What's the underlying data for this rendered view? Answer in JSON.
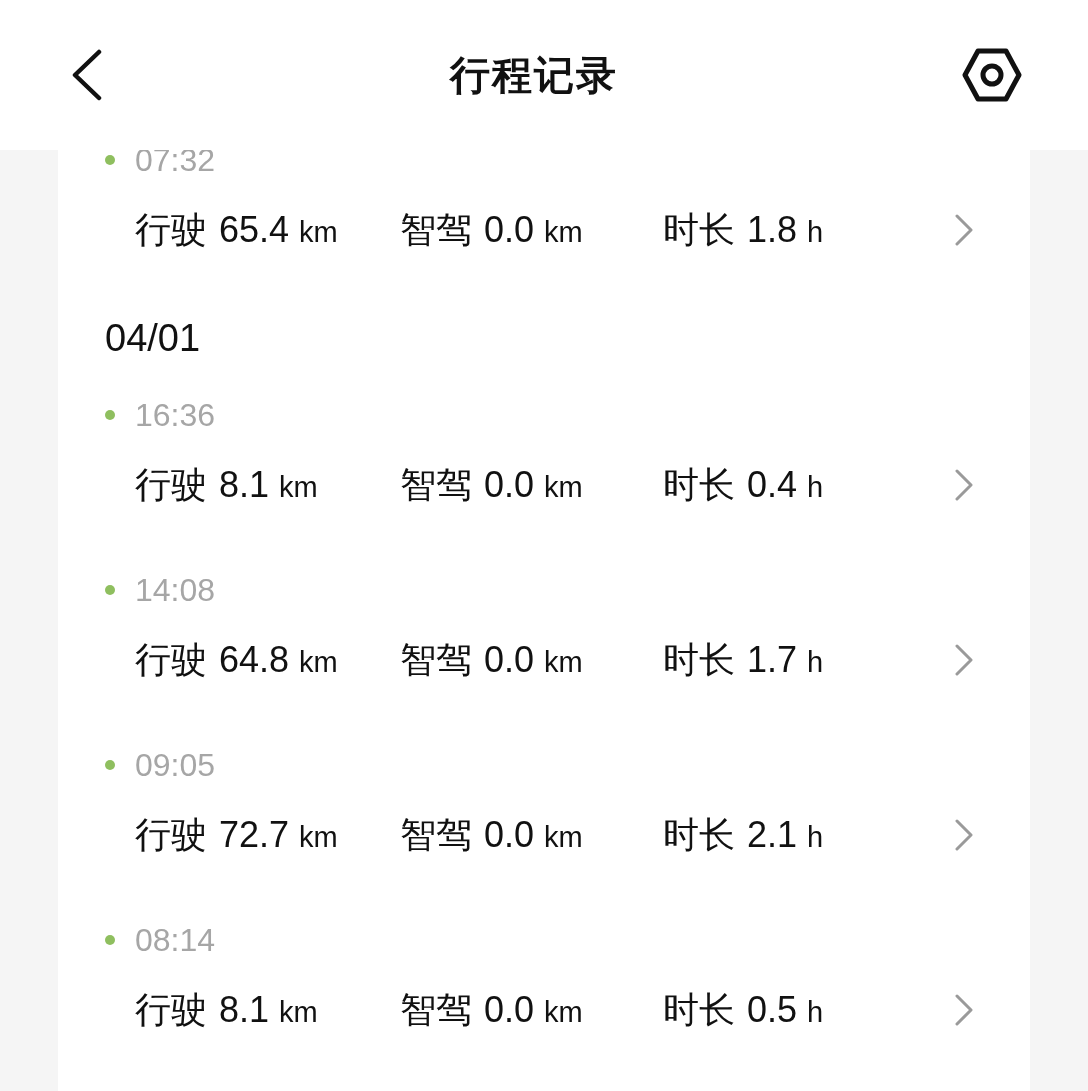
{
  "header": {
    "title": "行程记录"
  },
  "groups": [
    {
      "trips": [
        {
          "time": "07:32",
          "stats": [
            {
              "label": "行驶",
              "value": "65.4",
              "unit": "km"
            },
            {
              "label": "智驾",
              "value": "0.0",
              "unit": "km"
            },
            {
              "label": "时长",
              "value": "1.8",
              "unit": "h"
            }
          ]
        }
      ]
    },
    {
      "date": "04/01",
      "trips": [
        {
          "time": "16:36",
          "stats": [
            {
              "label": "行驶",
              "value": "8.1",
              "unit": "km"
            },
            {
              "label": "智驾",
              "value": "0.0",
              "unit": "km"
            },
            {
              "label": "时长",
              "value": "0.4",
              "unit": "h"
            }
          ]
        },
        {
          "time": "14:08",
          "stats": [
            {
              "label": "行驶",
              "value": "64.8",
              "unit": "km"
            },
            {
              "label": "智驾",
              "value": "0.0",
              "unit": "km"
            },
            {
              "label": "时长",
              "value": "1.7",
              "unit": "h"
            }
          ]
        },
        {
          "time": "09:05",
          "stats": [
            {
              "label": "行驶",
              "value": "72.7",
              "unit": "km"
            },
            {
              "label": "智驾",
              "value": "0.0",
              "unit": "km"
            },
            {
              "label": "时长",
              "value": "2.1",
              "unit": "h"
            }
          ]
        },
        {
          "time": "08:14",
          "stats": [
            {
              "label": "行驶",
              "value": "8.1",
              "unit": "km"
            },
            {
              "label": "智驾",
              "value": "0.0",
              "unit": "km"
            },
            {
              "label": "时长",
              "value": "0.5",
              "unit": "h"
            }
          ]
        }
      ]
    }
  ]
}
